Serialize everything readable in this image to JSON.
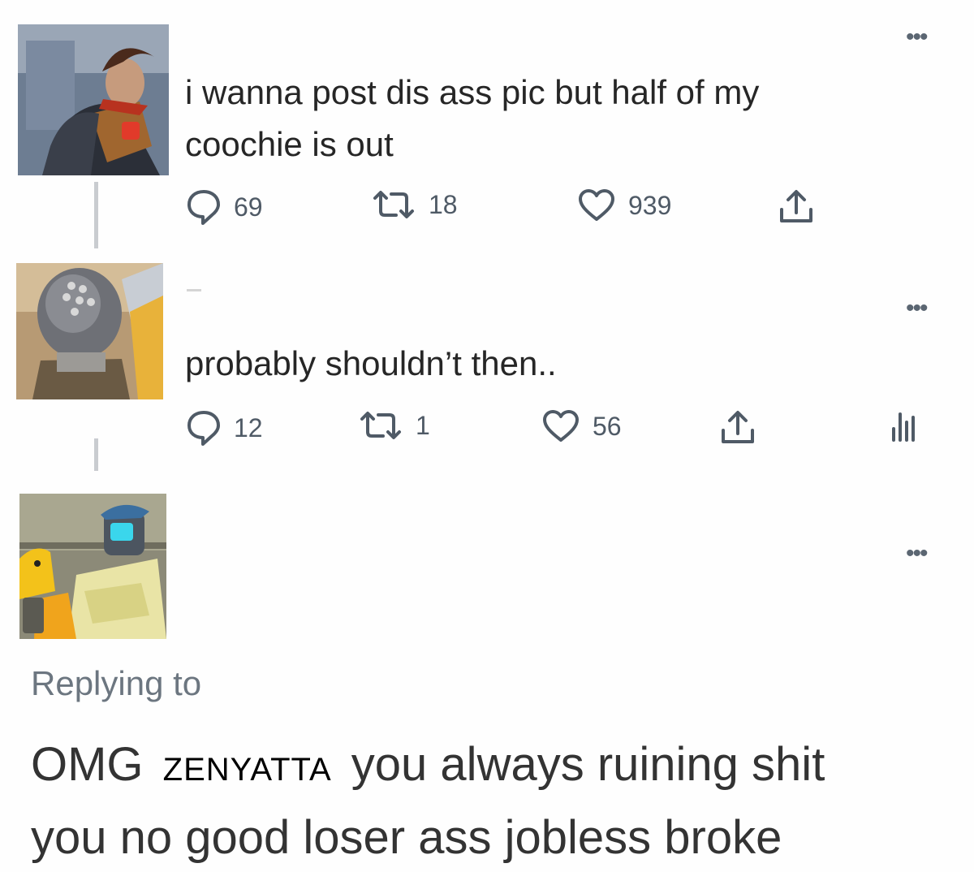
{
  "tweets": [
    {
      "text_lines": [
        "i wanna post dis ass pic but half of my",
        "coochie is out"
      ],
      "replies": "69",
      "retweets": "18",
      "likes": "939"
    },
    {
      "text_lines": [
        "probably shouldn’t then.."
      ],
      "replies": "12",
      "retweets": "1",
      "likes": "56"
    },
    {
      "text_lines": []
    }
  ],
  "reply": {
    "replying_to": "Replying to",
    "line1_start": "OMG",
    "overlay_name": "ZENYATTA",
    "line1_end": "you always ruining shit",
    "line2": "you no good loser ass jobless broke"
  },
  "icons": {
    "more": "more-dots-icon",
    "reply": "reply-bubble-icon",
    "retweet": "retweet-icon",
    "like": "heart-icon",
    "share": "share-icon",
    "analytics": "analytics-icon"
  },
  "colors": {
    "icon_gray": "#4f5a66",
    "thread_line": "#c9ccd0",
    "secondary_text": "#6c7680"
  }
}
